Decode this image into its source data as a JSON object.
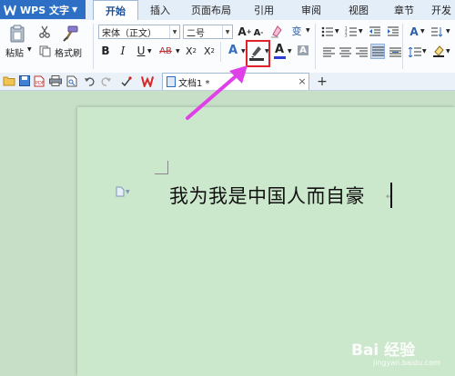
{
  "app": {
    "title": "WPS 文字"
  },
  "ribbon_tabs": [
    "开始",
    "插入",
    "页面布局",
    "引用",
    "审阅",
    "视图",
    "章节",
    "开发"
  ],
  "clipboard": {
    "paste_label": "粘贴",
    "format_painter_label": "格式刷"
  },
  "font": {
    "family": "宋体（正文）",
    "size": "二号"
  },
  "doc_tab": {
    "name": "文档1 *"
  },
  "document": {
    "text": "我为我是中国人而自豪"
  },
  "watermark": {
    "text": "Bai 经验",
    "url": "jingyan.baidu.com"
  },
  "colors": {
    "accent": "#2d6fc4",
    "page": "#cce8cc",
    "annotation_arrow": "#e040e8",
    "annotation_box": "#e0202a"
  },
  "icons": {
    "paste": "clipboard-icon",
    "cut": "scissors-icon",
    "format_painter": "brush-icon",
    "highlight": "highlighter-icon",
    "font_color": "font-color-icon"
  }
}
